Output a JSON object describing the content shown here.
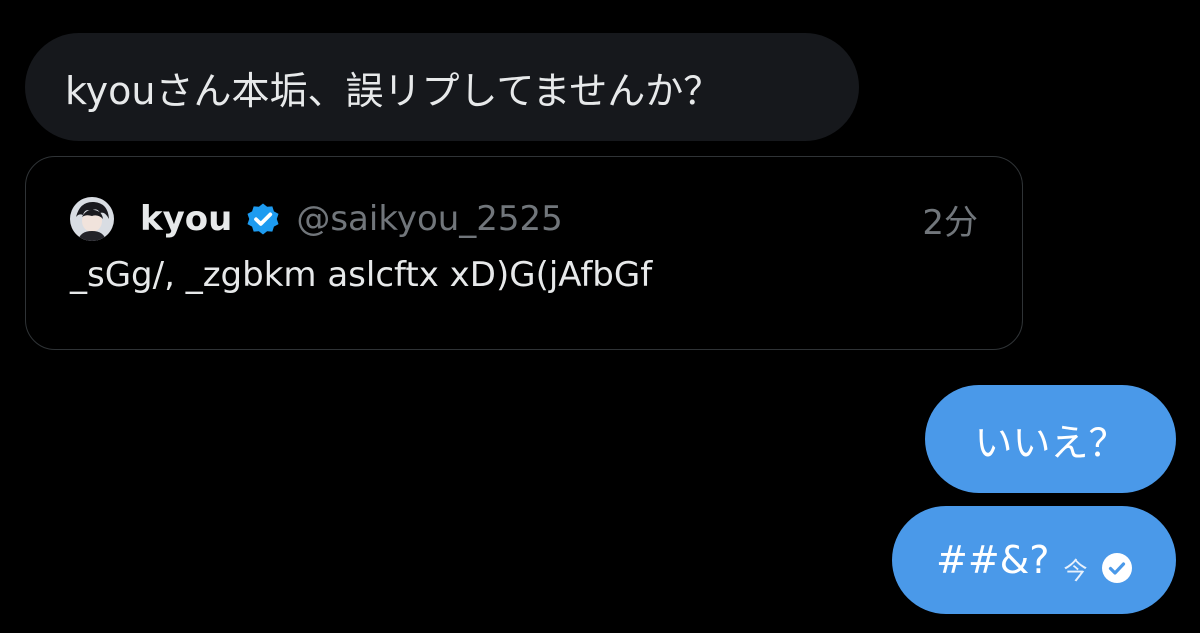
{
  "messages": {
    "received_text": "kyouさん本垢、誤リプしてませんか？",
    "quote": {
      "author_name": "kyou",
      "author_handle": "@saikyou_2525",
      "time": "2分",
      "text": "_sGg/, _zgbkm aslcftx xD)G(jAfbGf",
      "avatar_icon": "avatar-image",
      "verified_icon": "verified-badge-icon"
    },
    "sent": [
      {
        "text": "いいえ？"
      },
      {
        "text": "##&?",
        "time": "今",
        "status_icon": "read-check-icon"
      }
    ]
  },
  "colors": {
    "background": "#000000",
    "received_bubble": "#16181c",
    "sent_bubble": "#4a99e9",
    "secondary_text": "#71767b",
    "verified_blue": "#1d9bf0"
  }
}
